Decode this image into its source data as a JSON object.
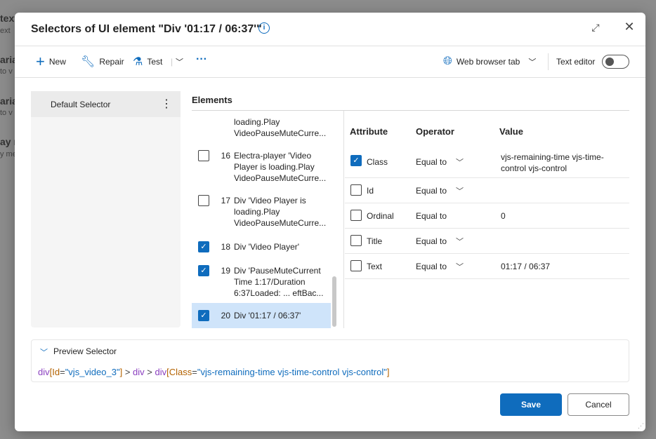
{
  "background": {
    "fragments": [
      {
        "title": "text",
        "sub": "ext"
      },
      {
        "title": "aria",
        "sub": "to v"
      },
      {
        "title": "aria",
        "sub": "to v"
      },
      {
        "title": "ay n",
        "sub": "y me"
      }
    ]
  },
  "dialog": {
    "title": "Selectors of UI element \"Div '01:17 / 06:37'\"",
    "info_icon": "info-icon"
  },
  "toolbar": {
    "new": "New",
    "repair": "Repair",
    "test": "Test",
    "more": "···",
    "target": "Web browser tab",
    "text_editor": "Text editor",
    "text_editor_on": false
  },
  "selectors": {
    "items": [
      {
        "label": "Default Selector"
      }
    ]
  },
  "elements": {
    "heading": "Elements",
    "items": [
      {
        "num": "",
        "text": "loading.Play VideoPauseMuteCurre...",
        "checked": null
      },
      {
        "num": "16",
        "text": "Electra-player 'Video Player is loading.Play VideoPauseMuteCurre...",
        "checked": false
      },
      {
        "num": "17",
        "text": "Div 'Video Player is loading.Play VideoPauseMuteCurre...",
        "checked": false
      },
      {
        "num": "18",
        "text": "Div 'Video Player'",
        "checked": true
      },
      {
        "num": "19",
        "text": "Div 'PauseMuteCurrent Time 1:17/Duration 6:37Loaded:  ... eftBac...",
        "checked": true
      },
      {
        "num": "20",
        "text": "Div '01:17 / 06:37'",
        "checked": true,
        "selected": true
      }
    ]
  },
  "attributes": {
    "headers": {
      "attribute": "Attribute",
      "operator": "Operator",
      "value": "Value"
    },
    "rows": [
      {
        "name": "Class",
        "operator": "Equal to",
        "value": "vjs-remaining-time vjs-time-control vjs-control",
        "checked": true,
        "dropdown": true
      },
      {
        "name": "Id",
        "operator": "Equal to",
        "value": "",
        "checked": false,
        "dropdown": true
      },
      {
        "name": "Ordinal",
        "operator": "Equal to",
        "value": "0",
        "checked": false,
        "dropdown": false
      },
      {
        "name": "Title",
        "operator": "Equal to",
        "value": "",
        "checked": false,
        "dropdown": true
      },
      {
        "name": "Text",
        "operator": "Equal to",
        "value": "01:17 / 06:37",
        "checked": false,
        "dropdown": true
      }
    ]
  },
  "preview": {
    "label": "Preview Selector",
    "parts": {
      "t1": "div",
      "b1": "[",
      "a1": "Id",
      "e1": "=",
      "s1": "\"vjs_video_3\"",
      "b2": "]",
      "g1": " > ",
      "t2": "div",
      "g2": " > ",
      "t3": "div",
      "b3": "[",
      "a2": "Class",
      "e2": "=",
      "s2": "\"vjs-remaining-time vjs-time-control vjs-control\"",
      "b4": "]"
    }
  },
  "buttons": {
    "save": "Save",
    "cancel": "Cancel"
  },
  "colors": {
    "accent": "#0f6cbd",
    "selected_row": "#cfe4fa",
    "tag": "#8a3fbf",
    "attr": "#b36200"
  }
}
